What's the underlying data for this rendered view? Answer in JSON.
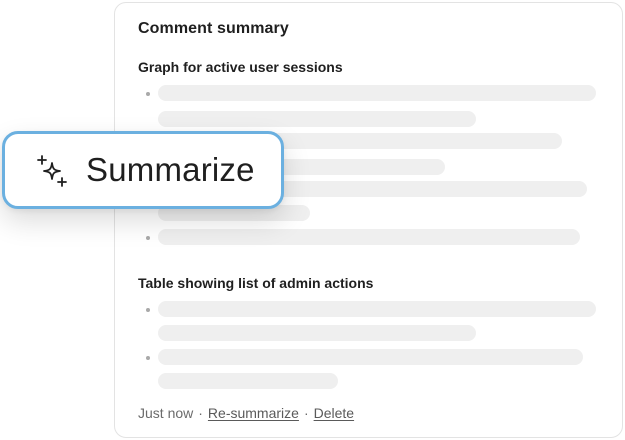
{
  "panel": {
    "title": "Comment summary",
    "sections": [
      {
        "heading": "Graph for active user sessions"
      },
      {
        "heading": "Table showing list of admin actions"
      }
    ],
    "footer": {
      "time": "Just now",
      "separator": "·",
      "resummarize_label": "Re-summarize",
      "delete_label": "Delete"
    }
  },
  "summarize_button": {
    "label": "Summarize",
    "icon": "sparkles-icon"
  },
  "colors": {
    "accent_border": "#6bb0e0",
    "skeleton": "#efefef"
  }
}
